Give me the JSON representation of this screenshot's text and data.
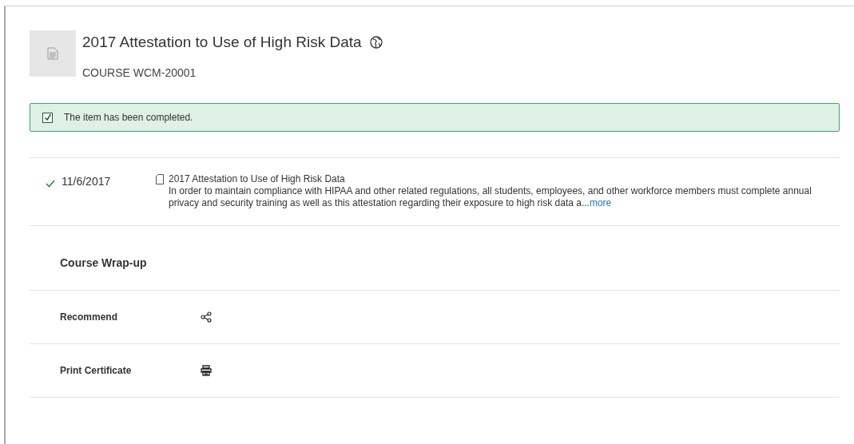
{
  "header": {
    "title": "2017 Attestation to Use of High Risk Data",
    "course_code": "COURSE WCM-20001"
  },
  "notice": {
    "text": "The item has been completed.",
    "checked": true
  },
  "activities": [
    {
      "completed": true,
      "date": "11/6/2017",
      "title": "2017 Attestation to Use of High Risk Data",
      "description": "In order to maintain compliance with HIPAA and other related regulations, all students, employees, and other workforce members must complete annual privacy and security training as well as this attestation regarding their exposure to high risk data a...",
      "more_link": "more"
    }
  ],
  "wrap_up": {
    "heading": "Course Wrap-up",
    "actions": [
      {
        "label": "Recommend",
        "kind": "share"
      },
      {
        "label": "Print Certificate",
        "kind": "print"
      }
    ]
  }
}
